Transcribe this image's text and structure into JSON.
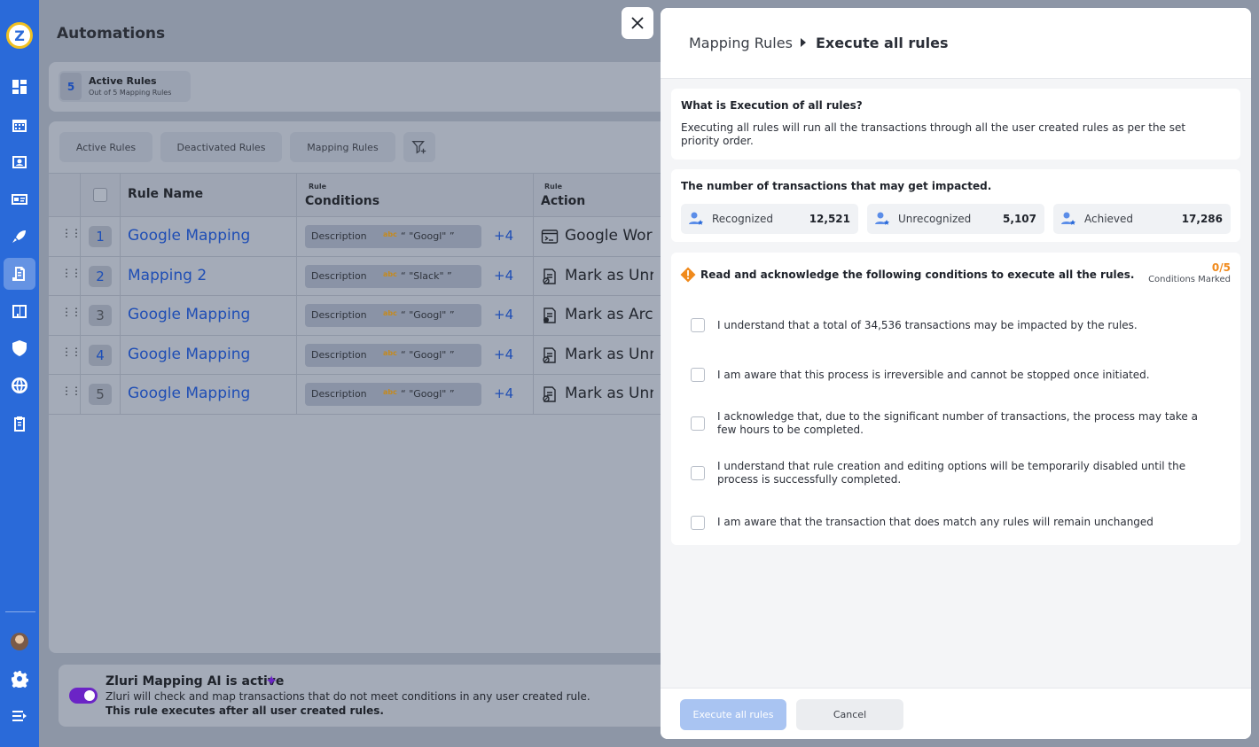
{
  "app": {
    "logo_letter": "Z",
    "accent_color": "#2a6ad9",
    "sidebar_icons": [
      "dashboard-icon",
      "calendar-icon",
      "contacts-icon",
      "id-card-icon",
      "rocket-icon",
      "automation-icon",
      "building-icon",
      "shield-icon",
      "globe-icon",
      "clipboard-icon",
      "settings-icon",
      "menu-expand-icon"
    ]
  },
  "page": {
    "title": "Automations",
    "active_rules_count": "5",
    "active_rules_label": "Active Rules",
    "active_rules_sub": "Out of 5 Mapping Rules"
  },
  "tabs": [
    "Active Rules",
    "Deactivated Rules",
    "Mapping Rules"
  ],
  "table": {
    "col_name": "Rule Name",
    "col_conditions_small": "Rule",
    "col_conditions": "Conditions",
    "col_action_small": "Rule",
    "col_action": "Action",
    "rows": [
      {
        "num": "1",
        "name": "Google Mapping",
        "field": "Description",
        "op": "abc",
        "value": "“ \"Googl\" ”",
        "more": "+4",
        "action": "Google Work",
        "action_icon": "terminal-icon"
      },
      {
        "num": "2",
        "name": "Mapping 2",
        "field": "Description",
        "op": "abc",
        "value": "“ \"Slack\" ”",
        "more": "+4",
        "action": "Mark as Unre",
        "action_icon": "mark-unrecognized-icon"
      },
      {
        "num": "3",
        "name": "Google Mapping",
        "field": "Description",
        "op": "abc",
        "value": "“ \"Googl\" ”",
        "more": "+4",
        "action": "Mark as Arch",
        "action_icon": "archive-icon"
      },
      {
        "num": "4",
        "name": "Google Mapping",
        "field": "Description",
        "op": "abc",
        "value": "“ \"Googl\" ”",
        "more": "+4",
        "action": "Mark as Unre",
        "action_icon": "mark-unrecognized-icon"
      },
      {
        "num": "5",
        "name": "Google Mapping",
        "field": "Description",
        "op": "abc",
        "value": "“ \"Googl\" ”",
        "more": "+4",
        "action": "Mark as Unre",
        "action_icon": "mark-unrecognized-icon"
      }
    ]
  },
  "ai": {
    "title": "Zluri Mapping AI is active",
    "desc": "Zluri will check and map transactions that do not meet conditions in any user created rule.",
    "note": "This rule executes after all user created rules.",
    "toggle_on": true
  },
  "drawer": {
    "crumb_parent": "Mapping Rules",
    "crumb_current": "Execute all rules",
    "what_title": "What is Execution of all rules?",
    "what_body": "Executing all rules will run all the transactions through all the user created rules as per the set priority order.",
    "impact_title": "The number of transactions that may get impacted.",
    "stats": [
      {
        "label": "Recognized",
        "value": "12,521"
      },
      {
        "label": "Unrecognized",
        "value": "5,107"
      },
      {
        "label": "Achieved",
        "value": "17,286"
      }
    ],
    "ack_title": "Read and acknowledge the following conditions to execute all the rules.",
    "marked_count": "0/5",
    "marked_label": "Conditions Marked",
    "conditions": [
      "I understand that a total of 34,536 transactions may be impacted by the rules.",
      "I am aware that this process is irreversible and cannot be stopped once initiated.",
      "I acknowledge that, due to the significant number of transactions, the process may take a few hours to be completed.",
      "I understand that rule creation and editing options will be temporarily disabled until the process is successfully completed.",
      "I am aware that the transaction that does match any rules will remain unchanged"
    ],
    "execute_label": "Execute all rules",
    "cancel_label": "Cancel"
  }
}
